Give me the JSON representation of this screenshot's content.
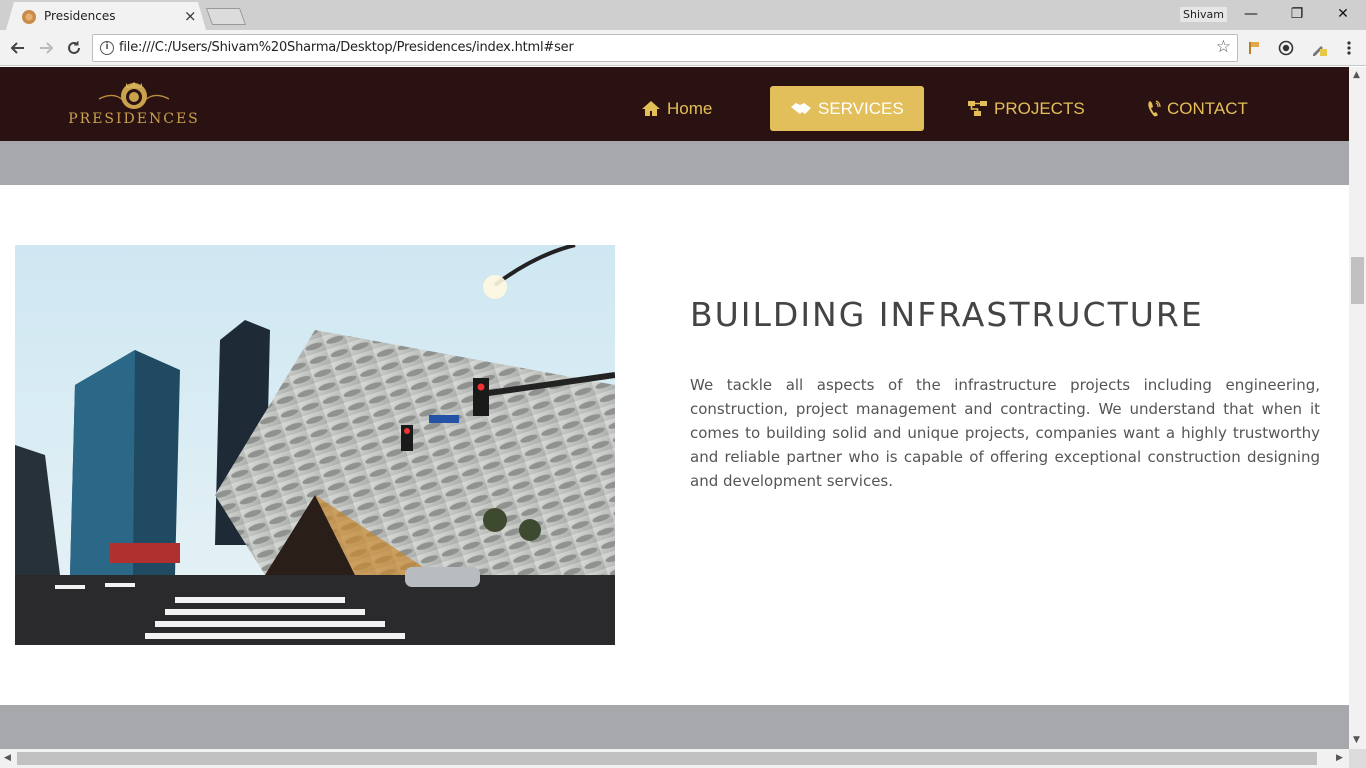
{
  "browser": {
    "tab_title": "Presidences",
    "tab_close": "×",
    "profile_name": "Shivam",
    "url": "file:///C:/Users/Shivam%20Sharma/Desktop/Presidences/index.html#ser",
    "window_controls": {
      "minimize": "—",
      "restore": "❐",
      "close": "✕"
    },
    "nav_icons": {
      "back": "back-arrow-icon",
      "forward": "forward-arrow-icon",
      "reload": "reload-icon"
    },
    "info_icon": "i",
    "star_icon": "☆"
  },
  "site": {
    "logo_text": "PRESIDENCES",
    "nav": {
      "home": "Home",
      "services": "SERVICES",
      "projects": "PROJECTS",
      "contact": "CONTACT"
    },
    "active_nav": "services",
    "colors": {
      "nav_bg": "#2a1212",
      "accent": "#e2bf5a",
      "band": "#a6a8ab",
      "heading": "#444444"
    }
  },
  "section": {
    "heading": "BUILDING INFRASTRUCTURE",
    "body": "We tackle all aspects of the infrastructure projects including engineering, construction, project management and contracting. We understand that when it comes to building solid and unique projects, companies want a highly trustworthy and reliable partner who is capable of offering exceptional construction designing and development services."
  }
}
